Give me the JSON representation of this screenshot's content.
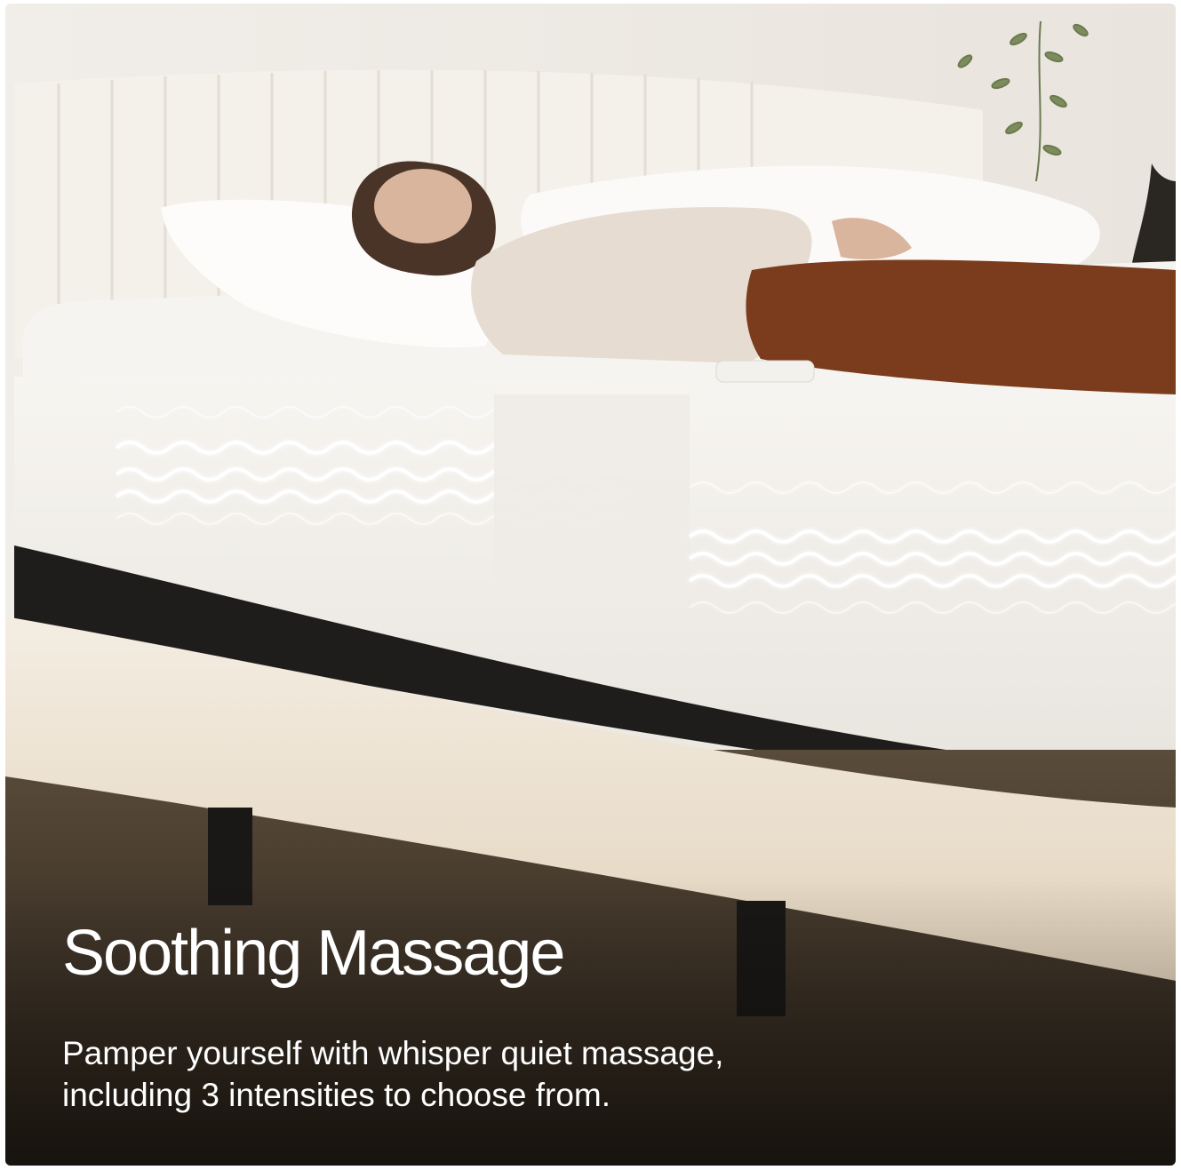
{
  "feature": {
    "title": "Soothing Massage",
    "description_lines": [
      "Pamper yourself with whisper quiet massage,",
      "including 3 intensities to choose from."
    ]
  },
  "colors": {
    "wall": "#efebe6",
    "headboard": "#f4efe8",
    "mattress": "#f2efea",
    "frame": "#efe4d3",
    "floor": "#3d3327",
    "pants": "#7a3c1c",
    "sweater": "#e7ddd2",
    "text": "#ffffff"
  },
  "icons": [
    "massage-wave-glow-icon"
  ]
}
